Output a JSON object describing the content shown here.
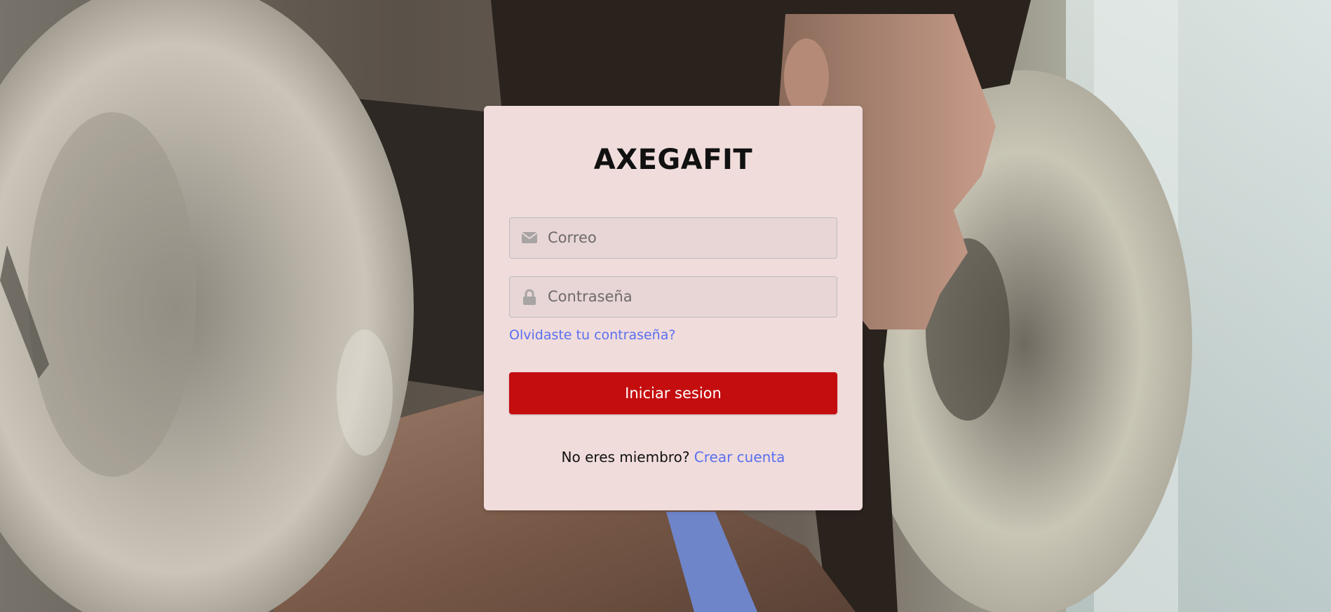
{
  "brand": {
    "title": "AXEGAFIT"
  },
  "form": {
    "email": {
      "placeholder": "Correo",
      "value": "",
      "icon": "envelope-icon"
    },
    "password": {
      "placeholder": "Contraseña",
      "value": "",
      "icon": "lock-icon"
    },
    "forgot_label": "Olvidaste tu contraseña?",
    "submit_label": "Iniciar sesion"
  },
  "signup": {
    "prompt": "No eres miembro?",
    "link_label": "Crear cuenta"
  },
  "colors": {
    "card_background": "#f0dcdb",
    "primary_button": "#c40d0f",
    "link": "#5a6ff0"
  }
}
